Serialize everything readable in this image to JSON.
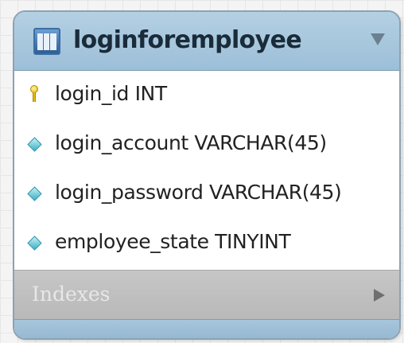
{
  "table": {
    "name": "loginforemployee",
    "icon": "table-icon",
    "collapse_icon": "collapse-triangle-icon"
  },
  "columns": [
    {
      "text": "login_id INT",
      "icon": "primary-key-icon"
    },
    {
      "text": "login_account VARCHAR(45)",
      "icon": "column-diamond-icon"
    },
    {
      "text": "login_password VARCHAR(45)",
      "icon": "column-diamond-icon"
    },
    {
      "text": "employee_state TINYINT",
      "icon": "column-diamond-icon"
    }
  ],
  "indexes": {
    "label": "Indexes",
    "expand_icon": "expand-arrow-icon"
  },
  "colors": {
    "header": "#a9c8dd",
    "footer": "#9dbdd5",
    "indexes_bar": "#bfbfbf",
    "key": "#e1b810",
    "diamond": "#3bb0c4"
  }
}
